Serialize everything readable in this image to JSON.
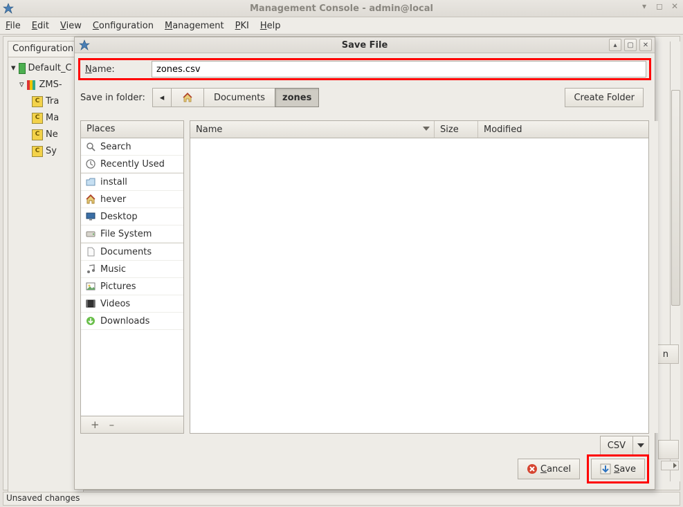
{
  "window": {
    "title": "Management Console - admin@local",
    "minimize_glyph": "▾",
    "restore_glyph": "◻",
    "close_glyph": "✕"
  },
  "menubar": [
    "File",
    "Edit",
    "View",
    "Configuration",
    "Management",
    "PKI",
    "Help"
  ],
  "tree": {
    "tab": "Configuration",
    "root": "Default_C",
    "zms": "ZMS-",
    "items": [
      "Tra",
      "Ma",
      "Ne",
      "Sy"
    ]
  },
  "statusbar": "Unsaved changes",
  "dialog": {
    "title": "Save File",
    "up_glyph": "◐",
    "restore_glyph": "▢",
    "close_glyph": "✕",
    "name_label": "Name:",
    "name_value": "zones.csv",
    "save_in_label": "Save in folder:",
    "back_glyph": "◂",
    "crumbs": [
      "Documents",
      "zones"
    ],
    "create_folder": "Create Folder",
    "places_header": "Places",
    "places": [
      "Search",
      "Recently Used",
      "install",
      "hever",
      "Desktop",
      "File System",
      "Documents",
      "Music",
      "Pictures",
      "Videos",
      "Downloads"
    ],
    "plus": "+",
    "minus": "–",
    "cols": {
      "name": "Name",
      "size": "Size",
      "mod": "Modified"
    },
    "type": "CSV",
    "cancel": "Cancel",
    "save": "Save"
  },
  "stub_button": "n"
}
